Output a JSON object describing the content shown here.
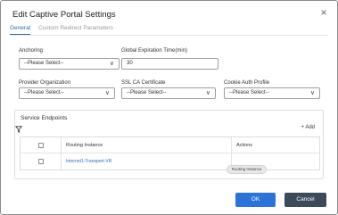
{
  "dialog": {
    "title": "Edit Captive Portal Settings",
    "close_glyph": "×"
  },
  "tabs": [
    {
      "label": "General",
      "active": true
    },
    {
      "label": "Custom Redirect Parameters",
      "active": false
    }
  ],
  "form": {
    "anchoring": {
      "label": "Anchoring",
      "value": "--Please Select--"
    },
    "global_expiration": {
      "label": "Global Expiration Time(min)",
      "value": "30"
    },
    "provider_org": {
      "label": "Provider Organization",
      "value": "--Please Select--"
    },
    "ssl_ca_cert": {
      "label": "SSL CA Certificate",
      "value": "--Please Select--"
    },
    "cookie_auth": {
      "label": "Cookie Auth Profile",
      "value": "--Please Select--"
    },
    "chevron_glyph": "⌵"
  },
  "service_endpoints": {
    "title": "Service Endpoints",
    "add_label": "+ Add",
    "columns": [
      "Routing Instance",
      "Actions"
    ],
    "rows": [
      {
        "routing_instance": "Internet1-Transport-VR",
        "actions": ""
      }
    ],
    "tooltip": "Routing Instance"
  },
  "buttons": {
    "ok": "OK",
    "cancel": "Cancel"
  },
  "colors": {
    "accent": "#2b6cb0",
    "ok_button": "#2b73d6",
    "cancel_button": "#3d4a5c"
  }
}
